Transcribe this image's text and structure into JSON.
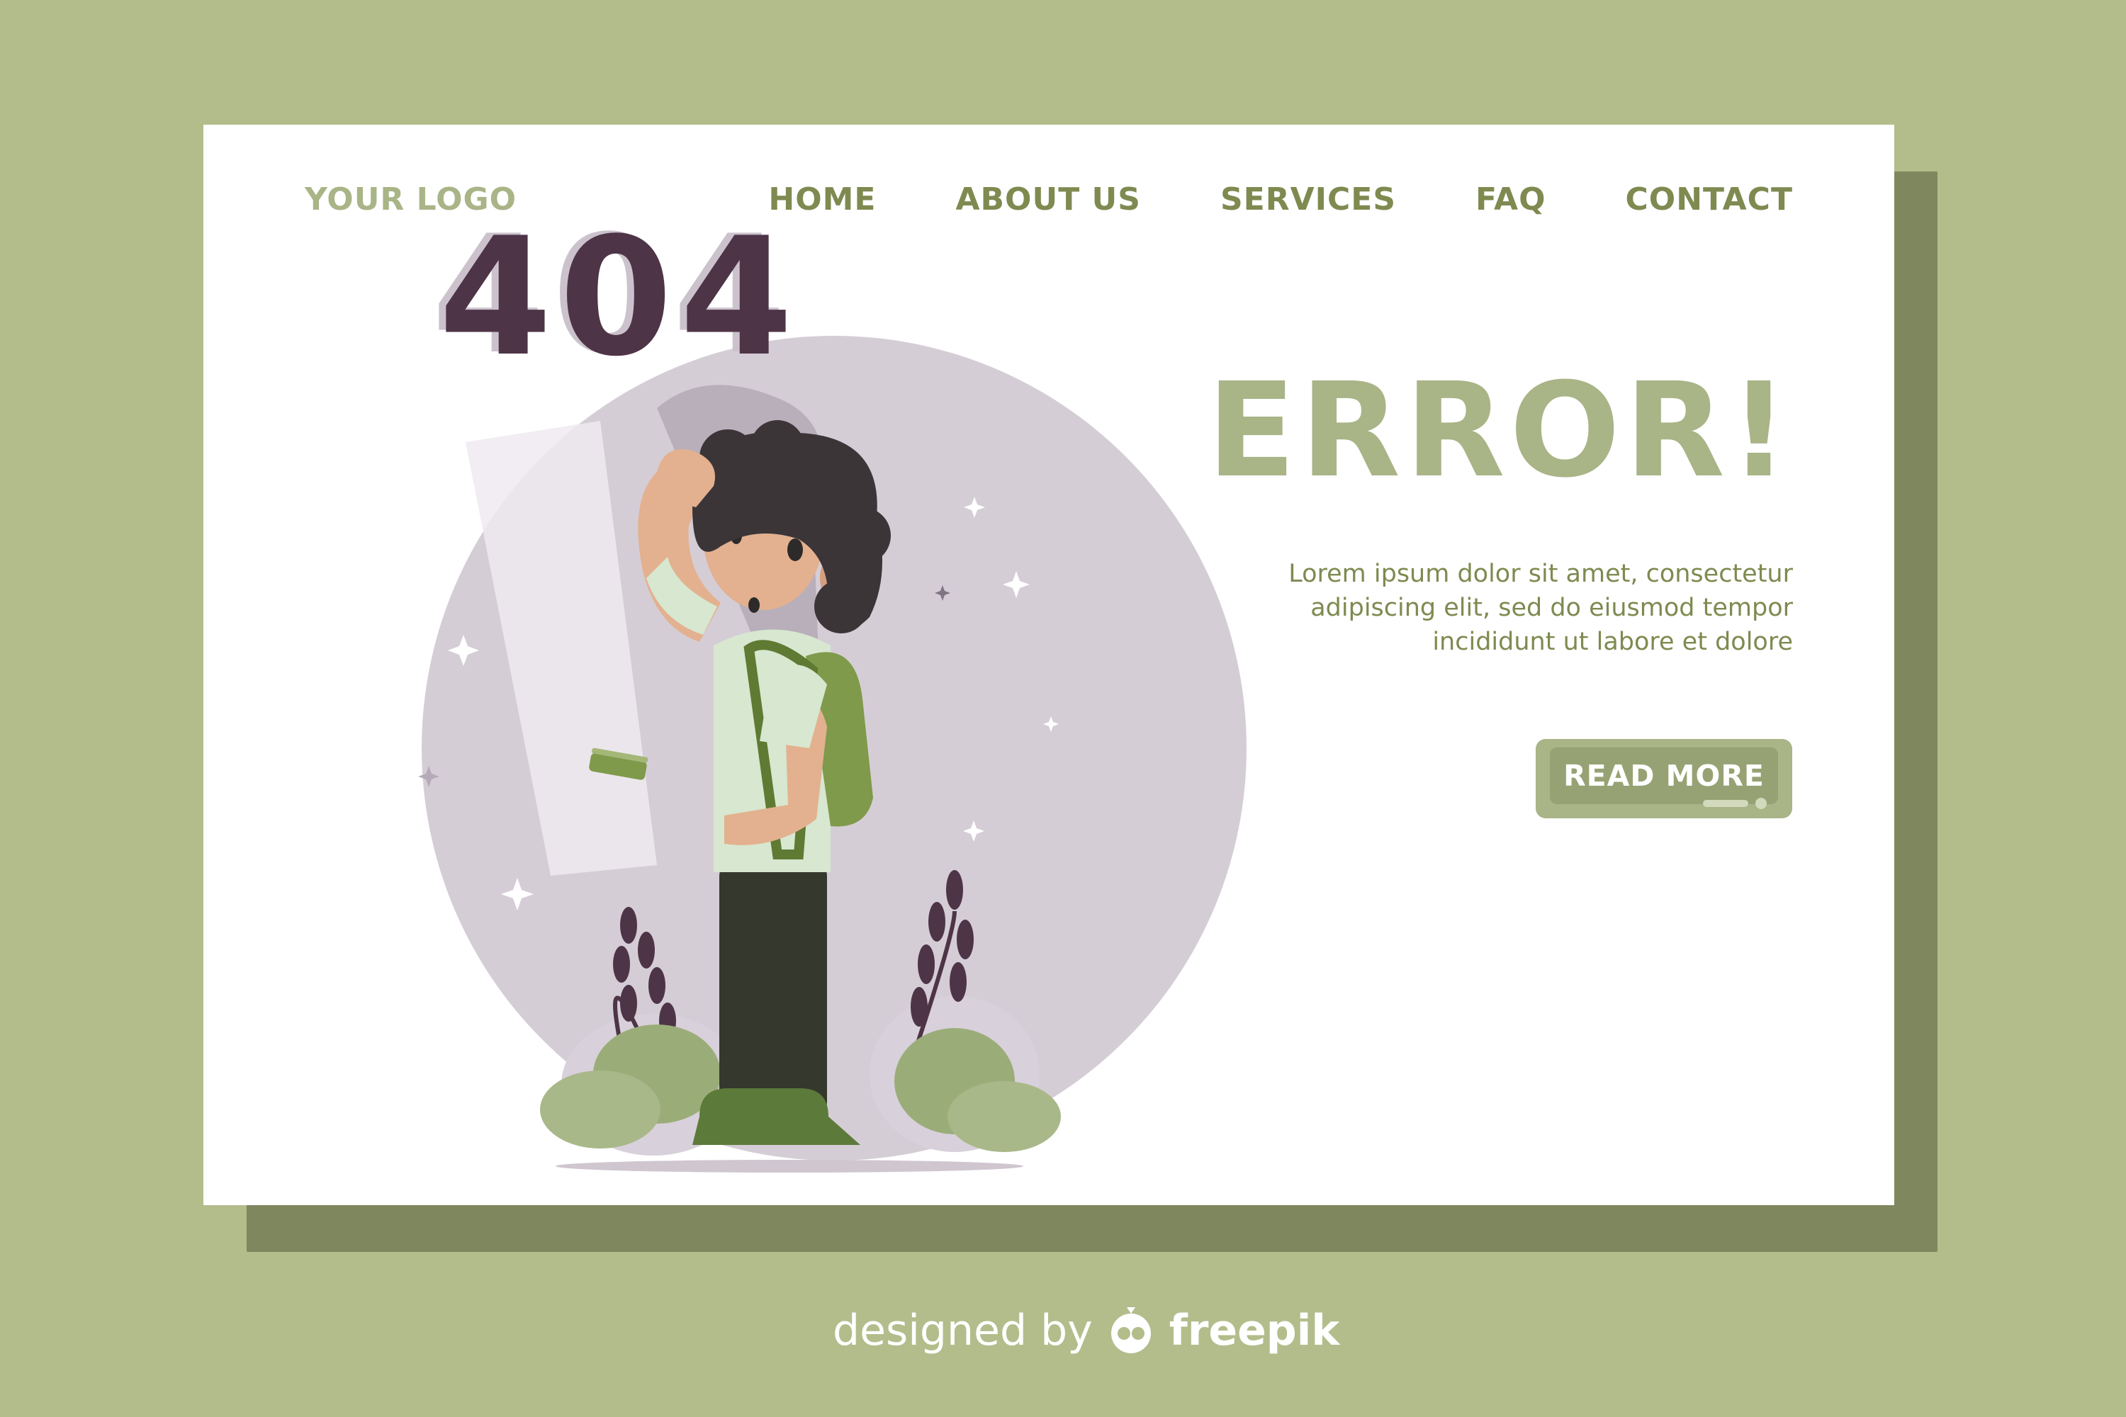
{
  "logo": "YOUR LOGO",
  "nav": {
    "home": "HOME",
    "about": "ABOUT US",
    "services": "SERVICES",
    "faq": "FAQ",
    "contact": "CONTACT"
  },
  "error_code": "404",
  "headline": "ERROR!",
  "body_text": "Lorem ipsum dolor sit amet, consectetur adipiscing elit, sed do eiusmod tempor incididunt ut labore et dolore",
  "cta_label": "READ MORE",
  "credit": {
    "prefix": "designed by",
    "brand": "freepik"
  },
  "colors": {
    "background": "#b2bd8b",
    "card": "#ffffff",
    "accent_light": "#a9b487",
    "accent_dark": "#7e8a50",
    "error_code": "#4e3447",
    "circle": "#d5cdd6"
  },
  "icons": {
    "credit_logo": "freepik-logo-icon"
  }
}
